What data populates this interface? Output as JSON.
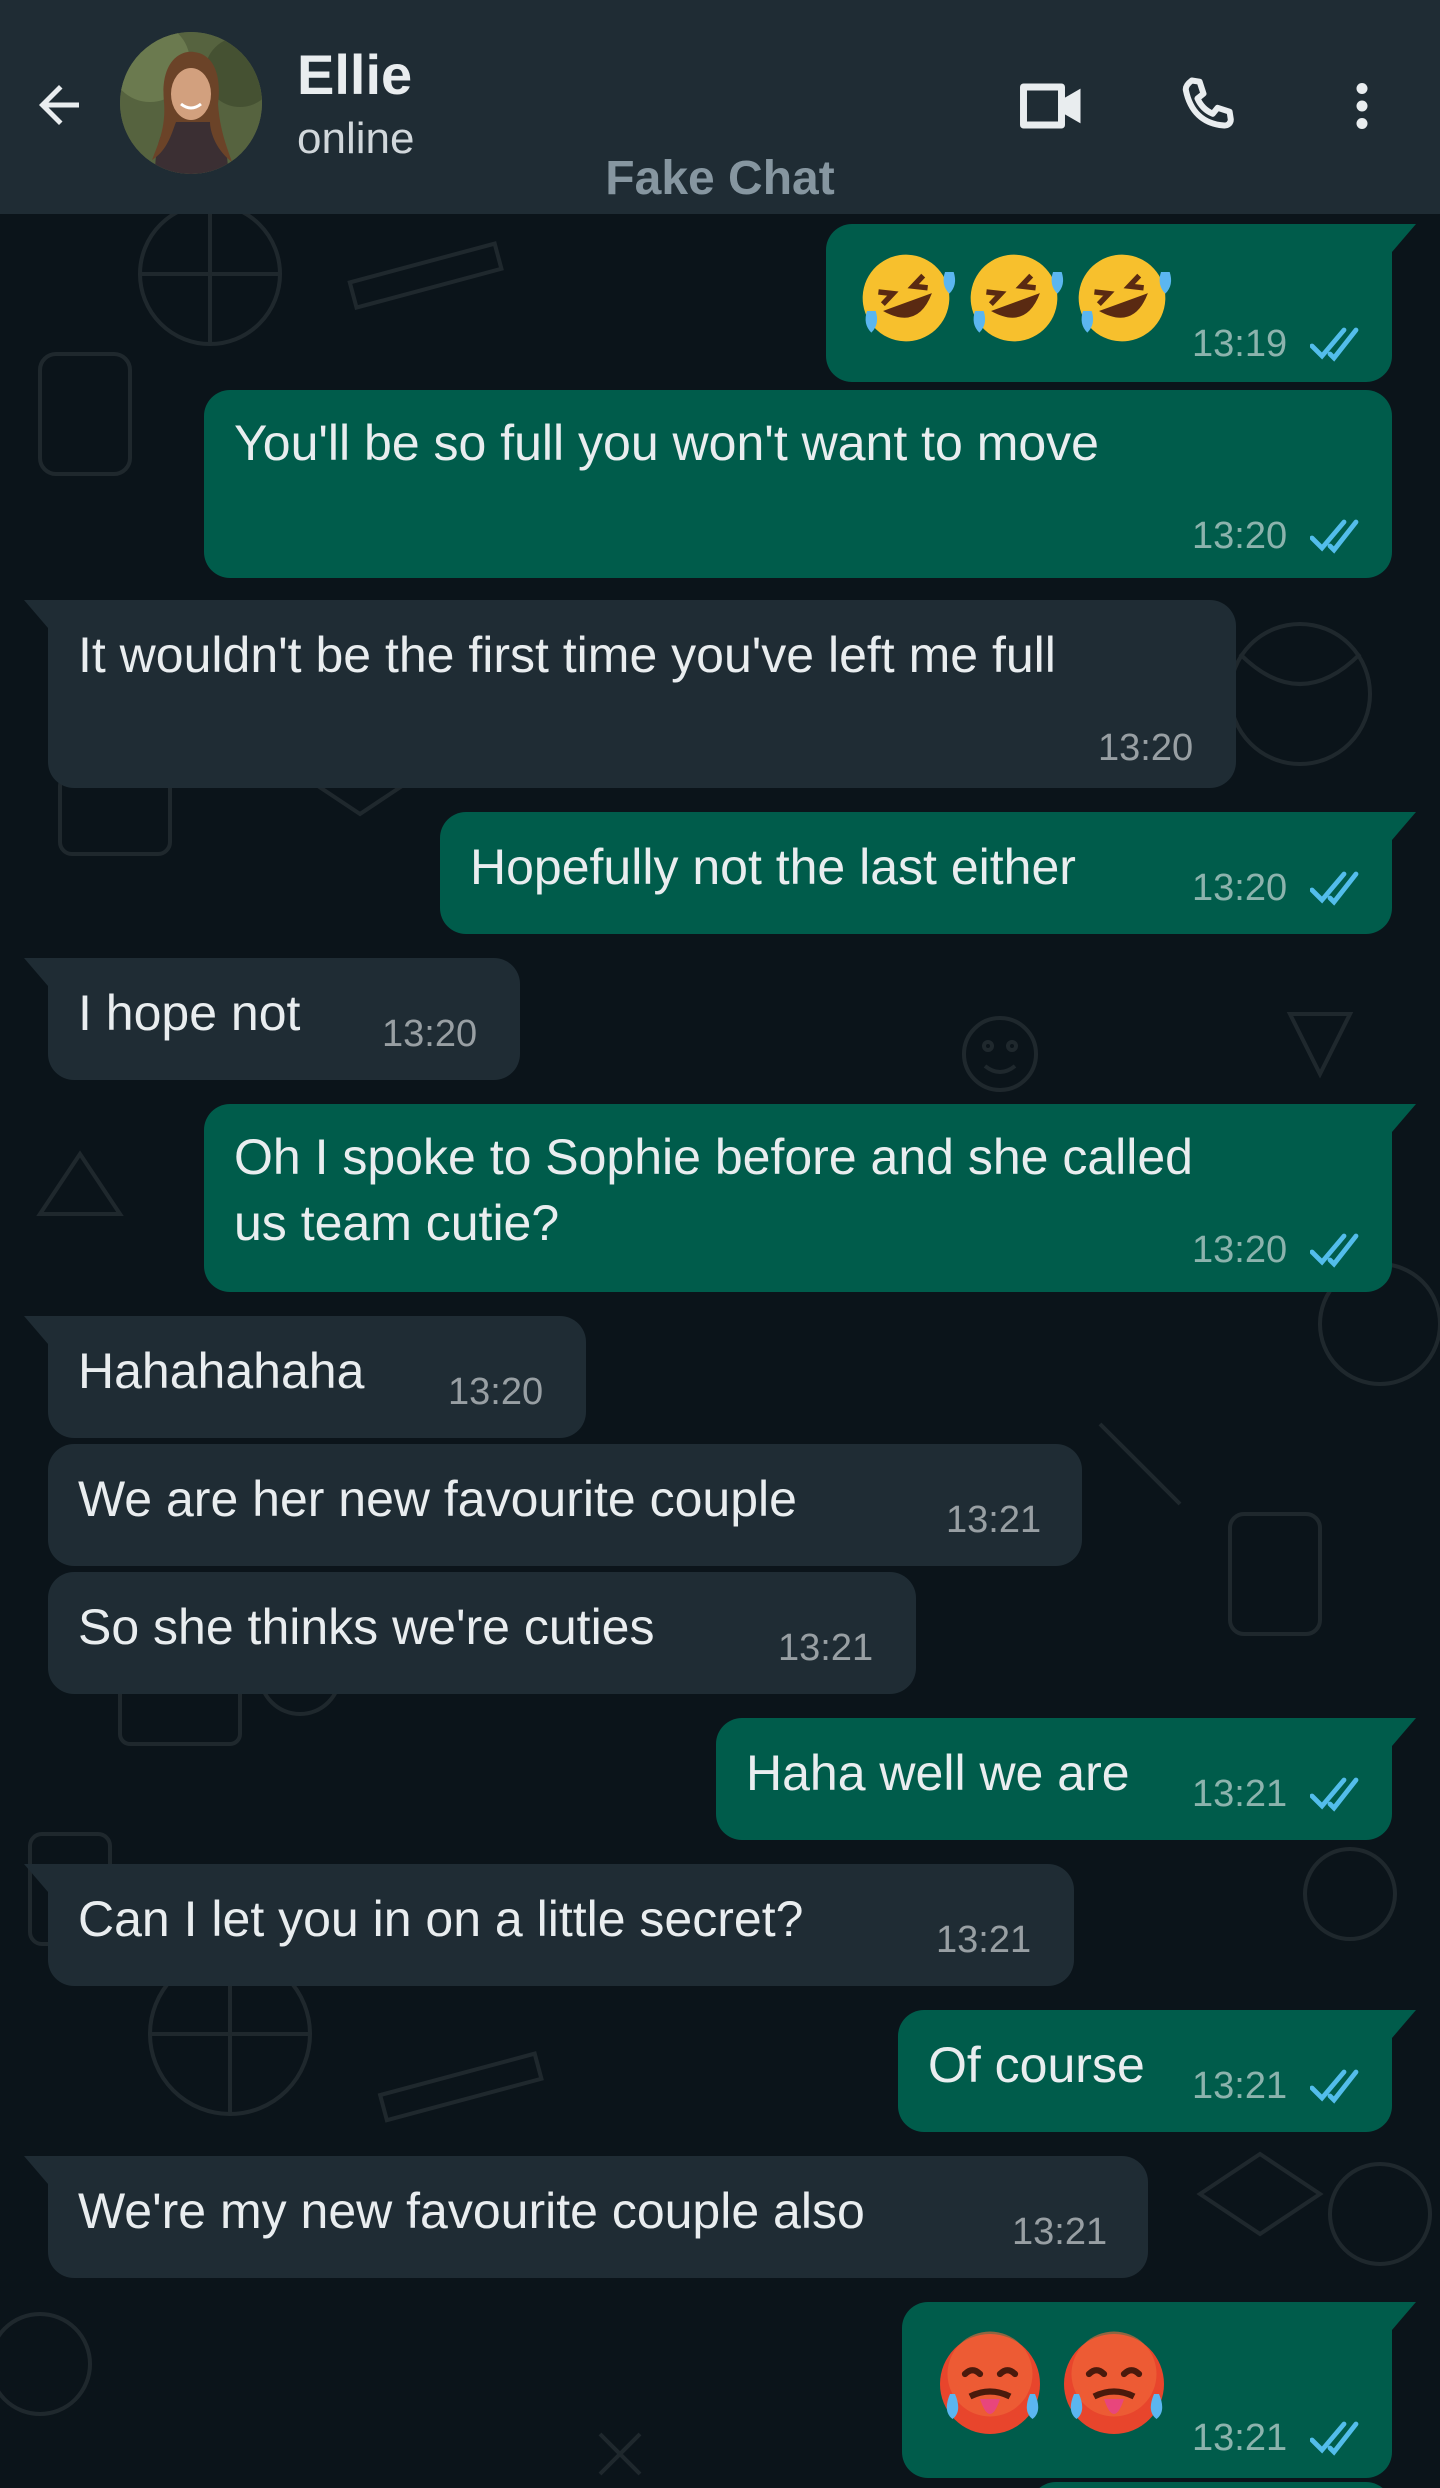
{
  "header": {
    "contact_name": "Ellie",
    "status": "online",
    "watermark": "Fake Chat",
    "icons": {
      "back": "arrow-left-icon",
      "video": "video-camera-icon",
      "call": "phone-icon",
      "menu": "more-vertical-icon"
    }
  },
  "colors": {
    "header_bg": "#1f2c34",
    "chat_bg": "#0b141a",
    "incoming_bubble": "#1f2c34",
    "outgoing_bubble": "#005c4b",
    "read_ticks": "#53bdeb",
    "text": "#e9edef"
  },
  "messages": [
    {
      "dir": "out",
      "emoji": [
        "rolling-on-floor-laughing",
        "rolling-on-floor-laughing",
        "rolling-on-floor-laughing"
      ],
      "time": "13:19",
      "status": "read"
    },
    {
      "dir": "out",
      "text": "You'll be so full you won't want to move",
      "time": "13:20",
      "status": "read"
    },
    {
      "dir": "in",
      "text": "It wouldn't be the first time you've left me full",
      "time": "13:20"
    },
    {
      "dir": "out",
      "text": "Hopefully not the last either",
      "time": "13:20",
      "status": "read"
    },
    {
      "dir": "in",
      "text": "I hope not",
      "time": "13:20"
    },
    {
      "dir": "out",
      "text": "Oh I spoke to Sophie before and she called",
      "text2": "us team cutie?",
      "time": "13:20",
      "status": "read"
    },
    {
      "dir": "in",
      "text": "Hahahahaha",
      "time": "13:20"
    },
    {
      "dir": "in",
      "text": "We are her new favourite couple",
      "time": "13:21"
    },
    {
      "dir": "in",
      "text": "So she thinks we're cuties",
      "time": "13:21"
    },
    {
      "dir": "out",
      "text": "Haha well we are",
      "time": "13:21",
      "status": "read"
    },
    {
      "dir": "in",
      "text": "Can I let you in on a little secret?",
      "time": "13:21"
    },
    {
      "dir": "out",
      "text": "Of course",
      "time": "13:21",
      "status": "read"
    },
    {
      "dir": "in",
      "text": "We're my new favourite couple also",
      "time": "13:21"
    },
    {
      "dir": "out",
      "emoji": [
        "hot-face",
        "hot-face"
      ],
      "time": "13:21",
      "status": "read"
    }
  ]
}
